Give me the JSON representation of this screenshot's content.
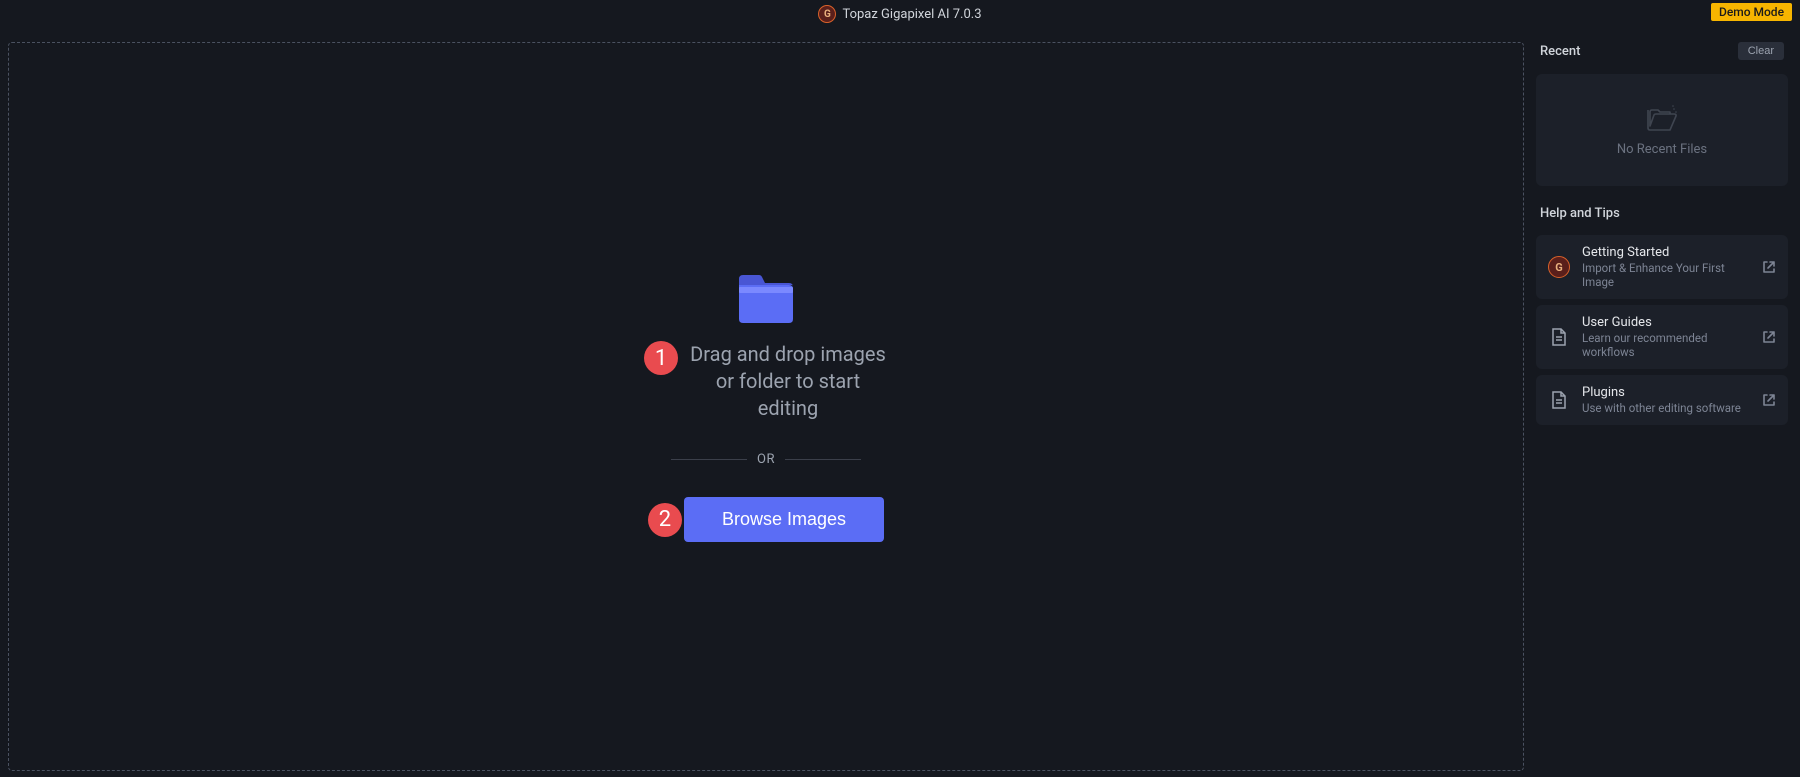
{
  "header": {
    "app_title": "Topaz Gigapixel AI 7.0.3",
    "logo_letter": "G",
    "demo_badge": "Demo Mode"
  },
  "drop_zone": {
    "step1_num": "1",
    "drag_text": "Drag and drop images or folder to start editing",
    "divider_label": "OR",
    "step2_num": "2",
    "browse_label": "Browse Images"
  },
  "sidebar": {
    "recent_title": "Recent",
    "clear_label": "Clear",
    "no_recent_text": "No Recent Files",
    "help_title": "Help and Tips",
    "help_items": [
      {
        "title": "Getting Started",
        "desc": "Import & Enhance Your First Image",
        "icon": "logo"
      },
      {
        "title": "User Guides",
        "desc": "Learn our recommended workflows",
        "icon": "doc"
      },
      {
        "title": "Plugins",
        "desc": "Use with other editing software",
        "icon": "doc"
      }
    ]
  }
}
